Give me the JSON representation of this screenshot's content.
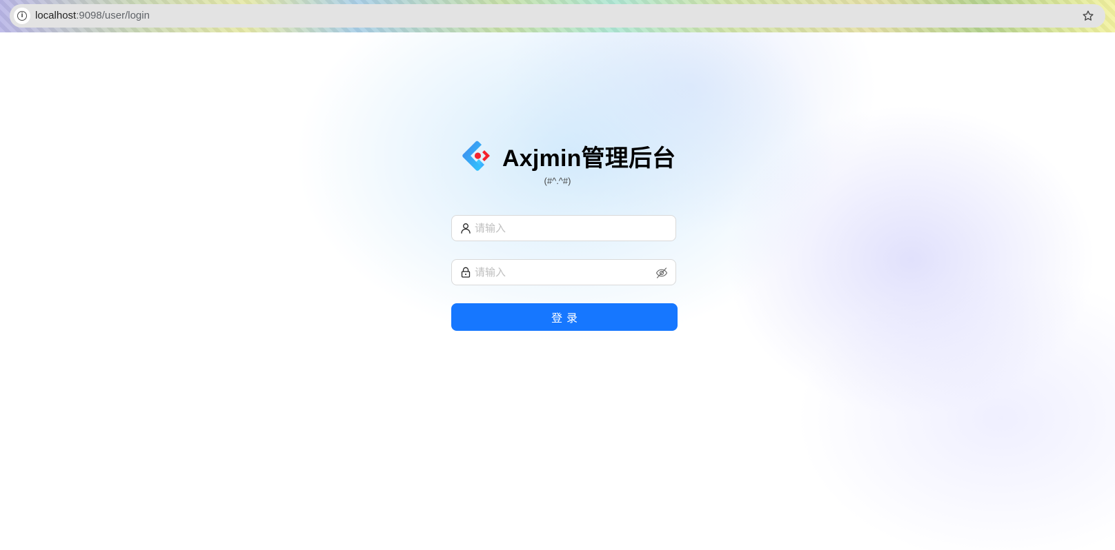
{
  "browser": {
    "url_host": "localhost",
    "url_path": ":9098/user/login",
    "info_icon": "info-icon",
    "bookmark_icon": "star-icon"
  },
  "login": {
    "title": "Axjmin管理后台",
    "subtitle": "(#^.^#)",
    "logo_icon": "ant-design-logo",
    "username": {
      "value": "",
      "placeholder": "请输入",
      "icon": "user-icon"
    },
    "password": {
      "value": "",
      "placeholder": "请输入",
      "icon": "lock-icon",
      "toggle_icon": "eye-invisible-icon"
    },
    "submit_label": "登录"
  },
  "colors": {
    "primary": "#1677ff",
    "logo_blue": "#1677ff",
    "logo_red": "#f5222d",
    "border": "#d9d9d9",
    "placeholder": "#bfbfbf"
  }
}
